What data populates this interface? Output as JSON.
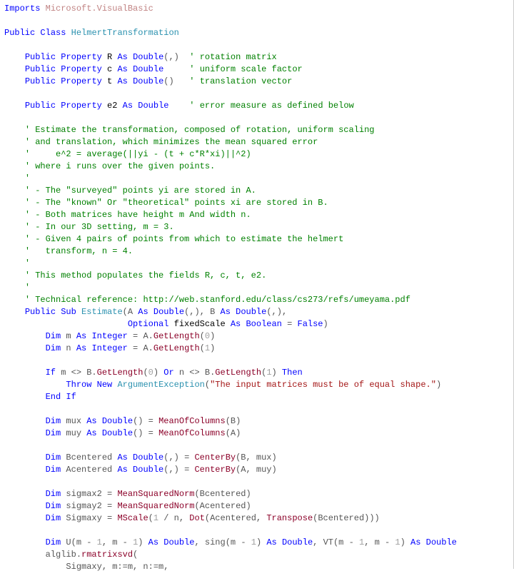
{
  "code": {
    "imports_kw": "Imports",
    "imports_ns": "Microsoft.VisualBasic",
    "public_kw": "Public",
    "class_kw": "Class",
    "class_name": "HelmertTransformation",
    "property_kw": "Property",
    "as_kw": "As",
    "double_t": "Double",
    "integer_t": "Integer",
    "boolean_t": "Boolean",
    "prop_R": "R",
    "prop_R_suffix": "(,)",
    "prop_R_cmt": "' rotation matrix",
    "prop_c": "c",
    "prop_c_cmt": "' uniform scale factor",
    "prop_t": "t",
    "prop_t_suffix": "()",
    "prop_t_cmt": "' translation vector",
    "prop_e2": "e2",
    "prop_e2_cmt": "' error measure as defined below",
    "c01": "' Estimate the transformation, composed of rotation, uniform scaling",
    "c02": "' and translation, which minimizes the mean squared error",
    "c03": "'     e^2 = average(||yi - (t + c*R*xi)||^2)",
    "c04": "' where i runs over the given points.",
    "c05": "'",
    "c06": "' - The \"surveyed\" points yi are stored in A.",
    "c07": "' - The \"known\" Or \"theoretical\" points xi are stored in B.",
    "c08": "' - Both matrices have height m And width n.",
    "c09": "' - In our 3D setting, m = 3.",
    "c10": "' - Given 4 pairs of points from which to estimate the helmert",
    "c11": "'   transform, n = 4.",
    "c12": "'",
    "c13": "' This method populates the fields R, c, t, e2.",
    "c14": "'",
    "c15": "' Technical reference: http://web.stanford.edu/class/cs273/refs/umeyama.pdf",
    "sub_kw": "Sub",
    "estimate_name": "Estimate",
    "paramA": "A",
    "paramB": "B",
    "arr2d": "(,)",
    "optional_kw": "Optional",
    "fixedScale": "fixedScale",
    "false_kw": "False",
    "dim_kw": "Dim",
    "m_name": "m",
    "n_name": "n",
    "getlength": "GetLength",
    "zero": "0",
    "one": "1",
    "if_kw": "If",
    "neq": "<>",
    "or_kw": "Or",
    "then_kw": "Then",
    "throw_kw": "Throw",
    "new_kw": "New",
    "argex": "ArgumentException",
    "err_str": "\"The input matrices must be of equal shape.\"",
    "endif_kw": "End If",
    "mux": "mux",
    "muy": "muy",
    "meanofcols": "MeanOfColumns",
    "Bcentered": "Bcentered",
    "Acentered": "Acentered",
    "centerby": "CenterBy",
    "sigmax2": "sigmax2",
    "sigmay2": "sigmay2",
    "msn": "MeanSquaredNorm",
    "Sigmaxy": "Sigmaxy",
    "mscale": "MScale",
    "dot": "Dot",
    "transpose": "Transpose",
    "U": "U",
    "sing": "sing",
    "VT": "VT",
    "alglib": "alglib",
    "rmatrixsvd": "rmatrixsvd",
    "svd_args": "            Sigmaxy, m:=m, n:=m,"
  }
}
